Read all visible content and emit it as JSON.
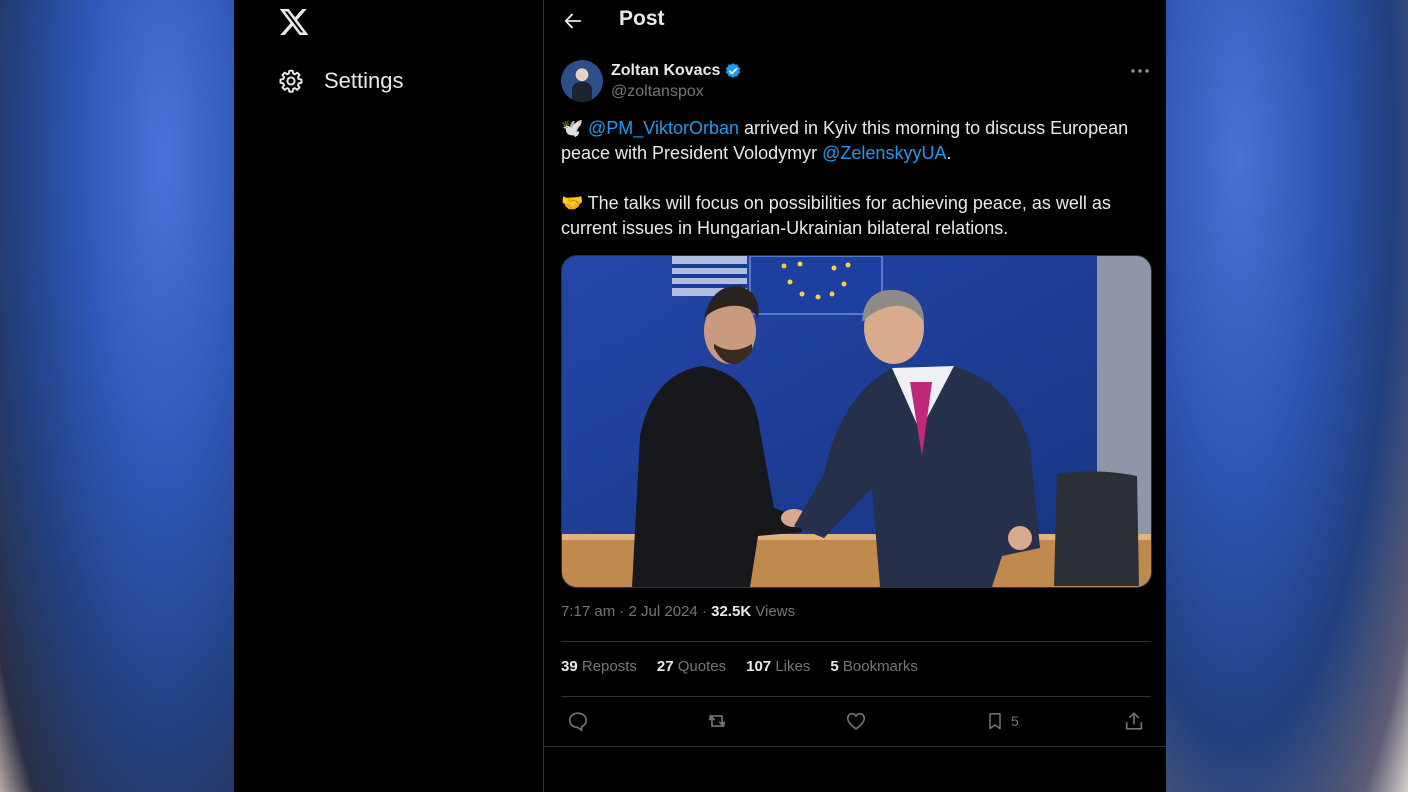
{
  "sidebar": {
    "settings_label": "Settings"
  },
  "header": {
    "title": "Post"
  },
  "post": {
    "author_name": "Zoltan Kovacs",
    "author_handle": "@zoltanspox",
    "paragraph1": {
      "emoji": "🕊️",
      "mention1": "@PM_ViktorOrban",
      "text1": " arrived in Kyiv this morning to discuss European peace with President Volodymyr ",
      "mention2": "@ZelenskyyUA",
      "text2": "."
    },
    "paragraph2": {
      "emoji": "🤝",
      "text": " The talks will focus on possibilities for achieving peace, as well as current issues in Hungarian-Ukrainian bilateral relations."
    },
    "time": "7:17 am",
    "date": "2 Jul 2024",
    "views_count": "32.5K",
    "views_label": "Views",
    "separator": "·"
  },
  "stats": {
    "reposts_count": "39",
    "reposts_label": "Reposts",
    "quotes_count": "27",
    "quotes_label": "Quotes",
    "likes_count": "107",
    "likes_label": "Likes",
    "bookmarks_count": "5",
    "bookmarks_label": "Bookmarks"
  },
  "actions": {
    "bookmark_count": "5"
  },
  "colors": {
    "accent": "#1d9bf0",
    "background": "#000000",
    "text": "#e7e9ea",
    "muted": "#71767b",
    "border": "#2f3336"
  }
}
